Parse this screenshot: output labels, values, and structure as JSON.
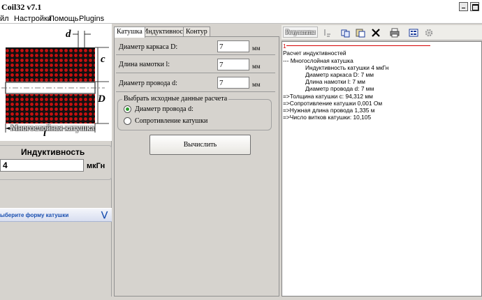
{
  "window": {
    "title": "Coil32 v7.1"
  },
  "menu": {
    "items": [
      "Файл",
      "Настройки",
      "Помощь",
      "Plugins"
    ],
    "items_visible": [
      "йл",
      "Настройки",
      "Помощь",
      "Plugins"
    ]
  },
  "coil": {
    "caption": "Многослойная катушка",
    "labels": {
      "d": "d",
      "c": "c",
      "D": "D",
      "l": "l"
    }
  },
  "inductance": {
    "title": "Индуктивность",
    "value": "4",
    "unit": "мкГн"
  },
  "shape_selector": {
    "label": "Выберите форму катушки",
    "label_visible": "ыберите форму катушки"
  },
  "tabs": [
    "Катушка",
    "Индуктивность",
    "Контур"
  ],
  "active_tab": "Катушка",
  "fields": [
    {
      "label": "Диаметр каркаса D:",
      "value": "7",
      "unit": "мм"
    },
    {
      "label": "Длина намотки l:",
      "value": "7",
      "unit": "мм"
    },
    {
      "label": "Диаметр провода d:",
      "value": "7",
      "unit": "мм"
    }
  ],
  "calc_group": {
    "title": "Выбрать исходные данные расчета",
    "options": [
      "Диаметр провода d:",
      "Сопротивление катушки"
    ],
    "selected": "Диаметр провода d:"
  },
  "calc_button": "Вычислить",
  "results": {
    "tab_label": "Результаты",
    "lines": [
      "1",
      "Расчет индуктивностей",
      "--- Многослойная катушка",
      "Индуктивность катушки 4 мкГн",
      "Диаметр каркаса D: 7 мм",
      "Длина намотки l: 7 мм",
      "Диаметр провода d: 7 мм",
      "=>Толщина катушки c: 94,312 мм",
      "=>Сопротивление катушки 0,001 Ом",
      "=>Нужная длина провода 1,335 м",
      "=>Число витков катушки: 10,105"
    ]
  },
  "toolbar_icons": [
    "info-icon",
    "copy-icon",
    "paste-icon",
    "clear-icon",
    "print-icon",
    "settings-icon",
    "gear-icon"
  ],
  "colors": {
    "accent": "#1a4fb0",
    "red_marker": "#d40000",
    "radio_on": "#2e9c2e"
  }
}
